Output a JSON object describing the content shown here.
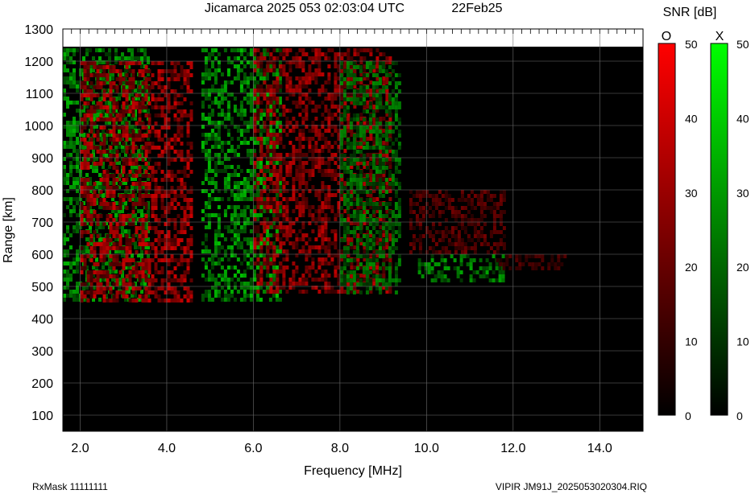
{
  "title": "Jicamarca 2025 053 02:03:04 UTC",
  "date_label": "22Feb25",
  "footer_left": "RxMask 11111111",
  "footer_right": "VIPIR  JM91J_2025053020304.RIQ",
  "colorbar": {
    "title": "SNR [dB]",
    "o_label": "O",
    "x_label": "X",
    "ticks": [
      0,
      10,
      20,
      30,
      40,
      50
    ],
    "o_color": "#ff0000",
    "x_color": "#00ff00",
    "range": [
      0,
      50
    ]
  },
  "chart_data": {
    "type": "heatmap",
    "title": "Jicamarca 2025 053 02:03:04 UTC",
    "xlabel": "Frequency [MHz]",
    "ylabel": "Range [km]",
    "xlim": [
      1.6,
      15.0
    ],
    "ylim": [
      50,
      1300
    ],
    "x_ticks": [
      "2.0",
      "4.0",
      "6.0",
      "8.0",
      "10.0",
      "12.0",
      "14.0"
    ],
    "y_ticks": [
      100,
      200,
      300,
      400,
      500,
      600,
      700,
      800,
      900,
      1000,
      1100,
      1200,
      1300
    ],
    "grid": true,
    "data_top_km": 1240,
    "series": [
      {
        "name": "O",
        "color": "#ff0000"
      },
      {
        "name": "X",
        "color": "#00ff00"
      }
    ],
    "echo_regions": [
      {
        "mode": "X",
        "f_start": 1.6,
        "f_end": 3.6,
        "range_start": 460,
        "range_end": 1240,
        "snr_db": 28
      },
      {
        "mode": "O",
        "f_start": 2.0,
        "f_end": 4.6,
        "range_start": 460,
        "range_end": 1200,
        "snr_db": 32
      },
      {
        "mode": "X",
        "f_start": 4.8,
        "f_end": 6.6,
        "range_start": 460,
        "range_end": 1240,
        "snr_db": 30
      },
      {
        "mode": "O",
        "f_start": 6.0,
        "f_end": 9.2,
        "range_start": 480,
        "range_end": 1240,
        "snr_db": 30
      },
      {
        "mode": "X",
        "f_start": 8.0,
        "f_end": 9.4,
        "range_start": 480,
        "range_end": 1200,
        "snr_db": 22
      },
      {
        "mode": "X",
        "f_start": 9.8,
        "f_end": 11.8,
        "range_start": 520,
        "range_end": 600,
        "snr_db": 26
      },
      {
        "mode": "O",
        "f_start": 9.6,
        "f_end": 11.8,
        "range_start": 600,
        "range_end": 800,
        "snr_db": 18
      },
      {
        "mode": "O",
        "f_start": 11.6,
        "f_end": 13.2,
        "range_start": 560,
        "range_end": 600,
        "snr_db": 14
      }
    ]
  }
}
